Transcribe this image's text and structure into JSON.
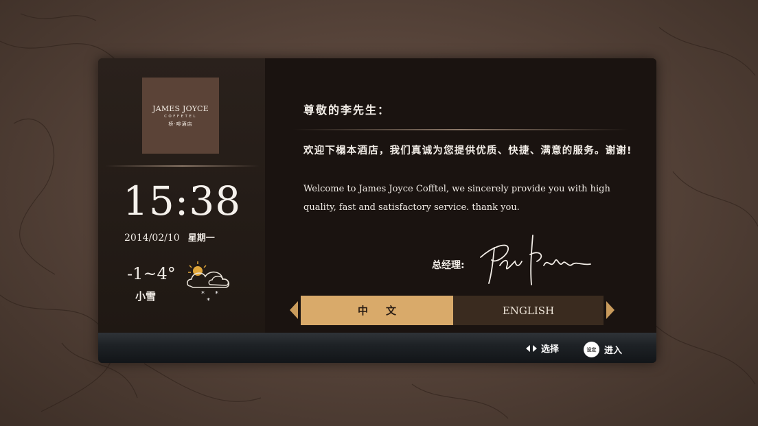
{
  "hotel": {
    "logo_main": "JAMES JOYCE",
    "logo_sub": "COFFETEL",
    "logo_cn": "桥·啡酒店"
  },
  "clock": {
    "time": "15:38",
    "date": "2014/02/10",
    "weekday": "星期一"
  },
  "weather": {
    "temperature": "-1~4°",
    "description": "小雪",
    "icon": "snow-cloud-sun-icon"
  },
  "welcome": {
    "greeting": "尊敬的李先生：",
    "message_cn": "欢迎下榻本酒店，我们真诚为您提供优质、快捷、满意的服务。谢谢!",
    "message_en": "Welcome to James Joyce Cofftel, we sincerely provide you with high quality, fast and satisfactory service. thank you.",
    "gm_label": "总经理:"
  },
  "language": {
    "options": [
      {
        "label": "中文",
        "selected": true
      },
      {
        "label": "ENGLISH",
        "selected": false
      }
    ]
  },
  "footer": {
    "select_label": "选择",
    "ok_key_label": "设定",
    "enter_label": "进入"
  },
  "colors": {
    "accent_gold": "#d9aa6a",
    "panel_dark": "#1c1410",
    "logo_brown": "#5b4337"
  }
}
